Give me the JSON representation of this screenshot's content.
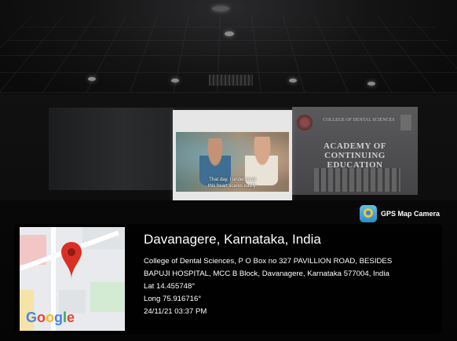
{
  "projection": {
    "subtitle_line1": "That day, I understood",
    "subtitle_line2": "this heart scares easily."
  },
  "banner": {
    "college_text": "COLLEGE OF DENTAL SCIENCES",
    "title": "ACADEMY OF CONTINUING EDUCATION"
  },
  "stamp": {
    "app_name": "GPS Map Camera",
    "map_logo": "Google",
    "pin_icon": "map-pin-icon",
    "city": "Davanagere, Karnataka, India",
    "address_line1": "College of Dental Sciences, P O Box no 327 PAVILLION ROAD, BESIDES",
    "address_line2": "BAPUJI HOSPITAL, MCC B Block, Davanagere, Karnataka 577004, India",
    "lat": "Lat 14.455748°",
    "long": "Long 75.916716°",
    "datetime": "24/11/21 03:37 PM"
  },
  "colors": {
    "pin": "#d93025",
    "google_blue": "#4285f4",
    "google_red": "#ea4335",
    "google_yellow": "#fbbc05",
    "google_green": "#34a853"
  }
}
